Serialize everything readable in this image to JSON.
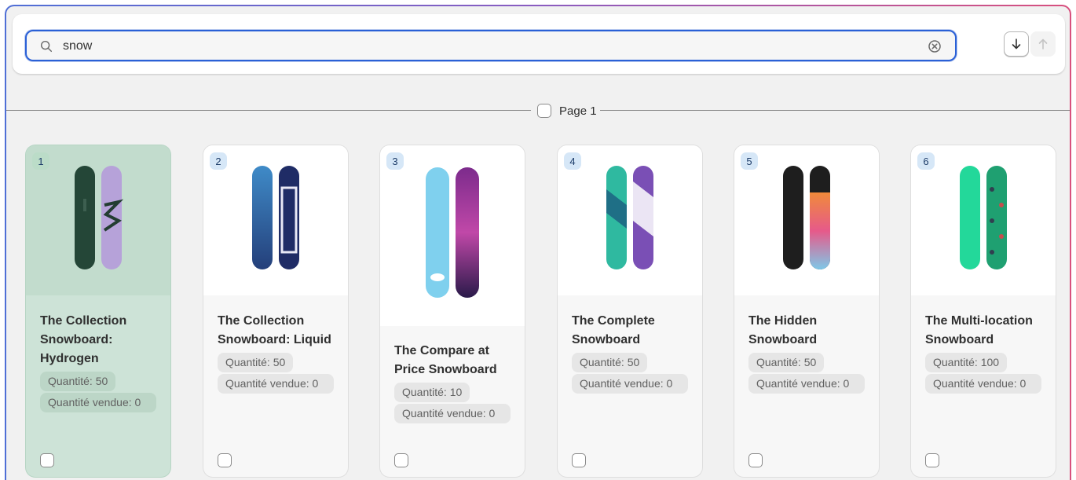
{
  "search": {
    "value": "snow",
    "placeholder": ""
  },
  "sort": {
    "down_label": "↓",
    "up_label": "↑"
  },
  "page": {
    "label": "Page 1"
  },
  "products": [
    {
      "index": "1",
      "title": "The Collection Snowboard: Hydrogen",
      "quantity": "Quantité: 50",
      "sold": "Quantité vendue: 0",
      "selected": true
    },
    {
      "index": "2",
      "title": "The Collection Snowboard: Liquid",
      "quantity": "Quantité: 50",
      "sold": "Quantité vendue: 0",
      "selected": false
    },
    {
      "index": "3",
      "title": "The Compare at Price Snowboard",
      "quantity": "Quantité: 10",
      "sold": "Quantité vendue: 0",
      "selected": false
    },
    {
      "index": "4",
      "title": "The Complete Snowboard",
      "quantity": "Quantité: 50",
      "sold": "Quantité vendue: 0",
      "selected": false
    },
    {
      "index": "5",
      "title": "The Hidden Snowboard",
      "quantity": "Quantité: 50",
      "sold": "Quantité vendue: 0",
      "selected": false
    },
    {
      "index": "6",
      "title": "The Multi-location Snowboard",
      "quantity": "Quantité: 100",
      "sold": "Quantité vendue: 0",
      "selected": false
    }
  ],
  "colors": {
    "focus_border": "#2a60d6",
    "selected_card": "#cde3d7",
    "index_badge": "#d6e7f7"
  }
}
